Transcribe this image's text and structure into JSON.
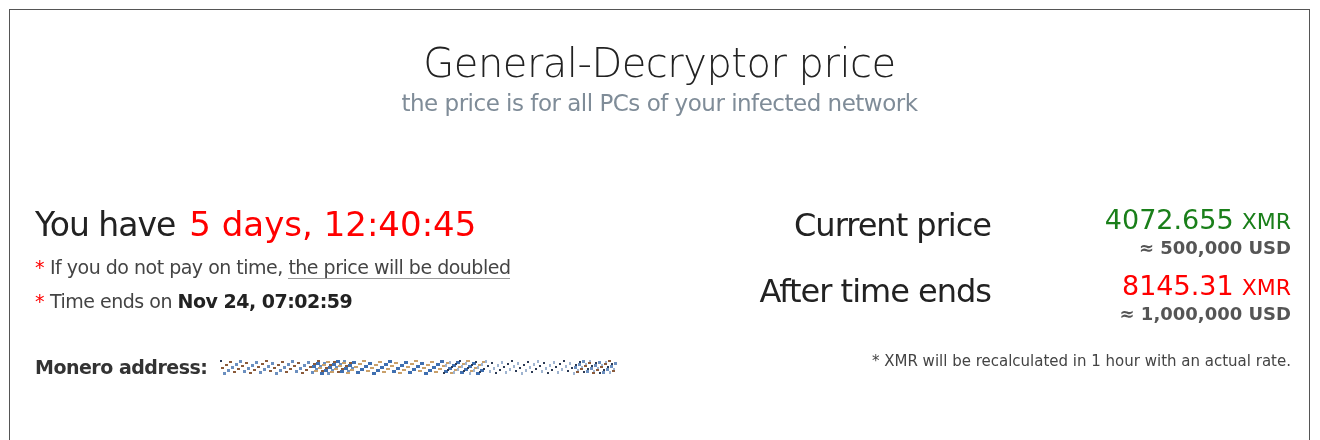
{
  "title": "General-Decryptor price",
  "subtitle": "the price is for all PCs of your infected network",
  "countdown": {
    "label": "You have",
    "value": "5 days, 12:40:45"
  },
  "notes": [
    {
      "mark": "*",
      "text": "If you do not pay on time, ",
      "link": "the price will be doubled"
    },
    {
      "mark": "*",
      "text": "Time ends on **Nov 24, 07:02:59**"
    }
  ],
  "address": {
    "label": "Monero address:"
  },
  "prices": [
    {
      "label": "Current price",
      "amount": "4072.655",
      "unit": "XMR",
      "usd": "≈ 500,000 USD",
      "color": "#1a7f1a"
    },
    {
      "label": "After time ends",
      "amount": "8145.31",
      "unit": "XMR",
      "usd": "≈ 1,000,000 USD",
      "color": "#ff0000"
    }
  ],
  "footnote": "* XMR will be recalculated in 1 hour with an actual rate."
}
